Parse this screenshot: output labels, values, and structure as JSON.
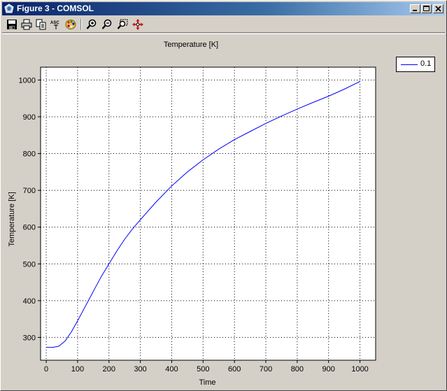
{
  "window": {
    "title": "Figure 3 - COMSOL"
  },
  "toolbar": {
    "buttons": [
      {
        "name": "save-icon"
      },
      {
        "name": "print-icon"
      },
      {
        "name": "copy-icon"
      },
      {
        "name": "ascii-export-icon",
        "label": "ASC"
      },
      {
        "name": "palette-icon"
      },
      {
        "name": "zoom-in-icon"
      },
      {
        "name": "zoom-out-icon"
      },
      {
        "name": "zoom-box-icon"
      },
      {
        "name": "pan-icon"
      }
    ]
  },
  "colors": {
    "series": "#0000ff",
    "grid": "#000000",
    "background": "#d4d0c8",
    "plot_area": "#ffffff"
  },
  "chart_data": {
    "type": "line",
    "title": "Temperature [K]",
    "xlabel": "Time",
    "ylabel": "Temperature [K]",
    "xlim": [
      -18,
      1050
    ],
    "ylim": [
      238,
      1035
    ],
    "xticks": [
      0,
      100,
      200,
      300,
      400,
      500,
      600,
      700,
      800,
      900,
      1000
    ],
    "yticks": [
      300,
      400,
      500,
      600,
      700,
      800,
      900,
      1000
    ],
    "grid": true,
    "legend_position": "top-right-outside",
    "series": [
      {
        "name": "0.1",
        "x": [
          0,
          20,
          40,
          60,
          80,
          100,
          125,
          150,
          175,
          200,
          225,
          250,
          275,
          300,
          350,
          400,
          450,
          500,
          550,
          600,
          650,
          700,
          750,
          800,
          850,
          900,
          950,
          1000
        ],
        "y": [
          273,
          273,
          276,
          290,
          315,
          345,
          385,
          425,
          465,
          500,
          535,
          567,
          595,
          620,
          668,
          712,
          750,
          783,
          812,
          838,
          860,
          882,
          902,
          921,
          939,
          956,
          975,
          996
        ]
      }
    ]
  }
}
